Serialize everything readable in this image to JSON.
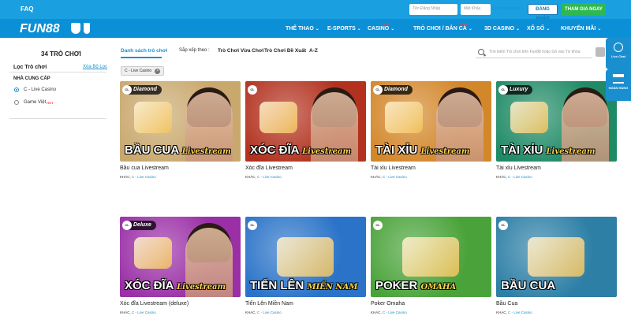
{
  "topbar": {
    "faq": "FAQ",
    "username_placeholder": "Tên Đăng Nhập",
    "password_placeholder": "Mật Khẩu",
    "forgot": "Quên mật khẩu ?",
    "login": "ĐĂNG NHẬP",
    "join": "THAM GIA NGAY"
  },
  "nav": {
    "logo": "FUN88",
    "items": [
      {
        "label": "THỂ THAO",
        "new": ""
      },
      {
        "label": "E-SPORTS",
        "new": ""
      },
      {
        "label": "CASINO",
        "new": "NEW"
      },
      {
        "label": "TRÒ CHƠI / BẮN CÁ",
        "new": "NEW"
      },
      {
        "label": "3D CASINO",
        "new": ""
      },
      {
        "label": "XỔ SỐ",
        "new": ""
      },
      {
        "label": "KHUYẾN MÃI",
        "new": ""
      }
    ]
  },
  "sidebar": {
    "count": "34 TRÒ CHƠI",
    "filter_title": "Lọc Trò chơi",
    "clear_filter": "Xóa Bộ Lọc",
    "provider_title": "NHÀ CUNG CẤP",
    "providers": [
      {
        "label": "C - Live Casino",
        "checked": true,
        "hot": ""
      },
      {
        "label": "Game Việt",
        "checked": false,
        "hot": "HOT"
      }
    ]
  },
  "toolbar": {
    "list_tab": "Danh sách trò chơi",
    "sort_label": "Sắp xếp theo :",
    "sort_options": [
      "Trò Chơi Vừa Chơi",
      "Trò Chơi Đề Xuất",
      "A-Z"
    ],
    "search_placeholder": "Tìm kiếm Trò chơi trên Fun88 hoặc Gõ vào Từ khóa"
  },
  "chip": "C - Live Casino",
  "games": [
    {
      "name": "Bầu cua Livestream",
      "meta_prefix": "KHÁC,",
      "provider": "C - Live Casino",
      "tag": "Diamond",
      "title_main": "BẦU CUA",
      "title_sub": "Livestream",
      "bg": "#c9a86e"
    },
    {
      "name": "Xóc đĩa Livestream",
      "meta_prefix": "KHÁC,",
      "provider": "C - Live Casino",
      "tag": "",
      "title_main": "XÓC ĐĨA",
      "title_sub": "Livestream",
      "bg": "#b2321f"
    },
    {
      "name": "Tài xỉu Livestream",
      "meta_prefix": "KHÁC,",
      "provider": "C - Live Casino",
      "tag": "Diamond",
      "title_main": "TÀI XỈU",
      "title_sub": "Livestream",
      "bg": "#d3872b"
    },
    {
      "name": "Tài xỉu Livestream",
      "meta_prefix": "KHÁC,",
      "provider": "C - Live Casino",
      "tag": "Luxury",
      "title_main": "TÀI XỈU",
      "title_sub": "Livestream",
      "bg": "#1f8a66"
    },
    {
      "name": "Xóc đĩa Livestream (deluxe)",
      "meta_prefix": "KHÁC,",
      "provider": "C - Live Casino",
      "tag": "Deluxe",
      "title_main": "XÓC ĐĨA",
      "title_sub": "Livestream",
      "bg": "#9a2fa6"
    },
    {
      "name": "Tiến Lên Miền Nam",
      "meta_prefix": "KHÁC,",
      "provider": "C - Live Casino",
      "tag": "",
      "title_main": "TIẾN LÊN",
      "title_sub": "MIỀN NAM",
      "bg": "#2a73c8"
    },
    {
      "name": "Poker Omaha",
      "meta_prefix": "KHÁC,",
      "provider": "C - Live Casino",
      "tag": "",
      "title_main": "POKER",
      "title_sub": "OMAHA",
      "bg": "#4aa33a"
    },
    {
      "name": "Bầu Cua",
      "meta_prefix": "KHÁC,",
      "provider": "C - Live Casino",
      "tag": "",
      "title_main": "BẦU CUA",
      "title_sub": "",
      "bg": "#2d7fa6"
    }
  ],
  "side_buttons": [
    "Live Chat",
    "NGÂN HÀNG"
  ],
  "colors": {
    "accent": "#1a8fd0",
    "topbar": "#1aa0e0",
    "navbar": "#0b8fd6",
    "join": "#2fb84f",
    "badge": "#ff3b3b"
  }
}
